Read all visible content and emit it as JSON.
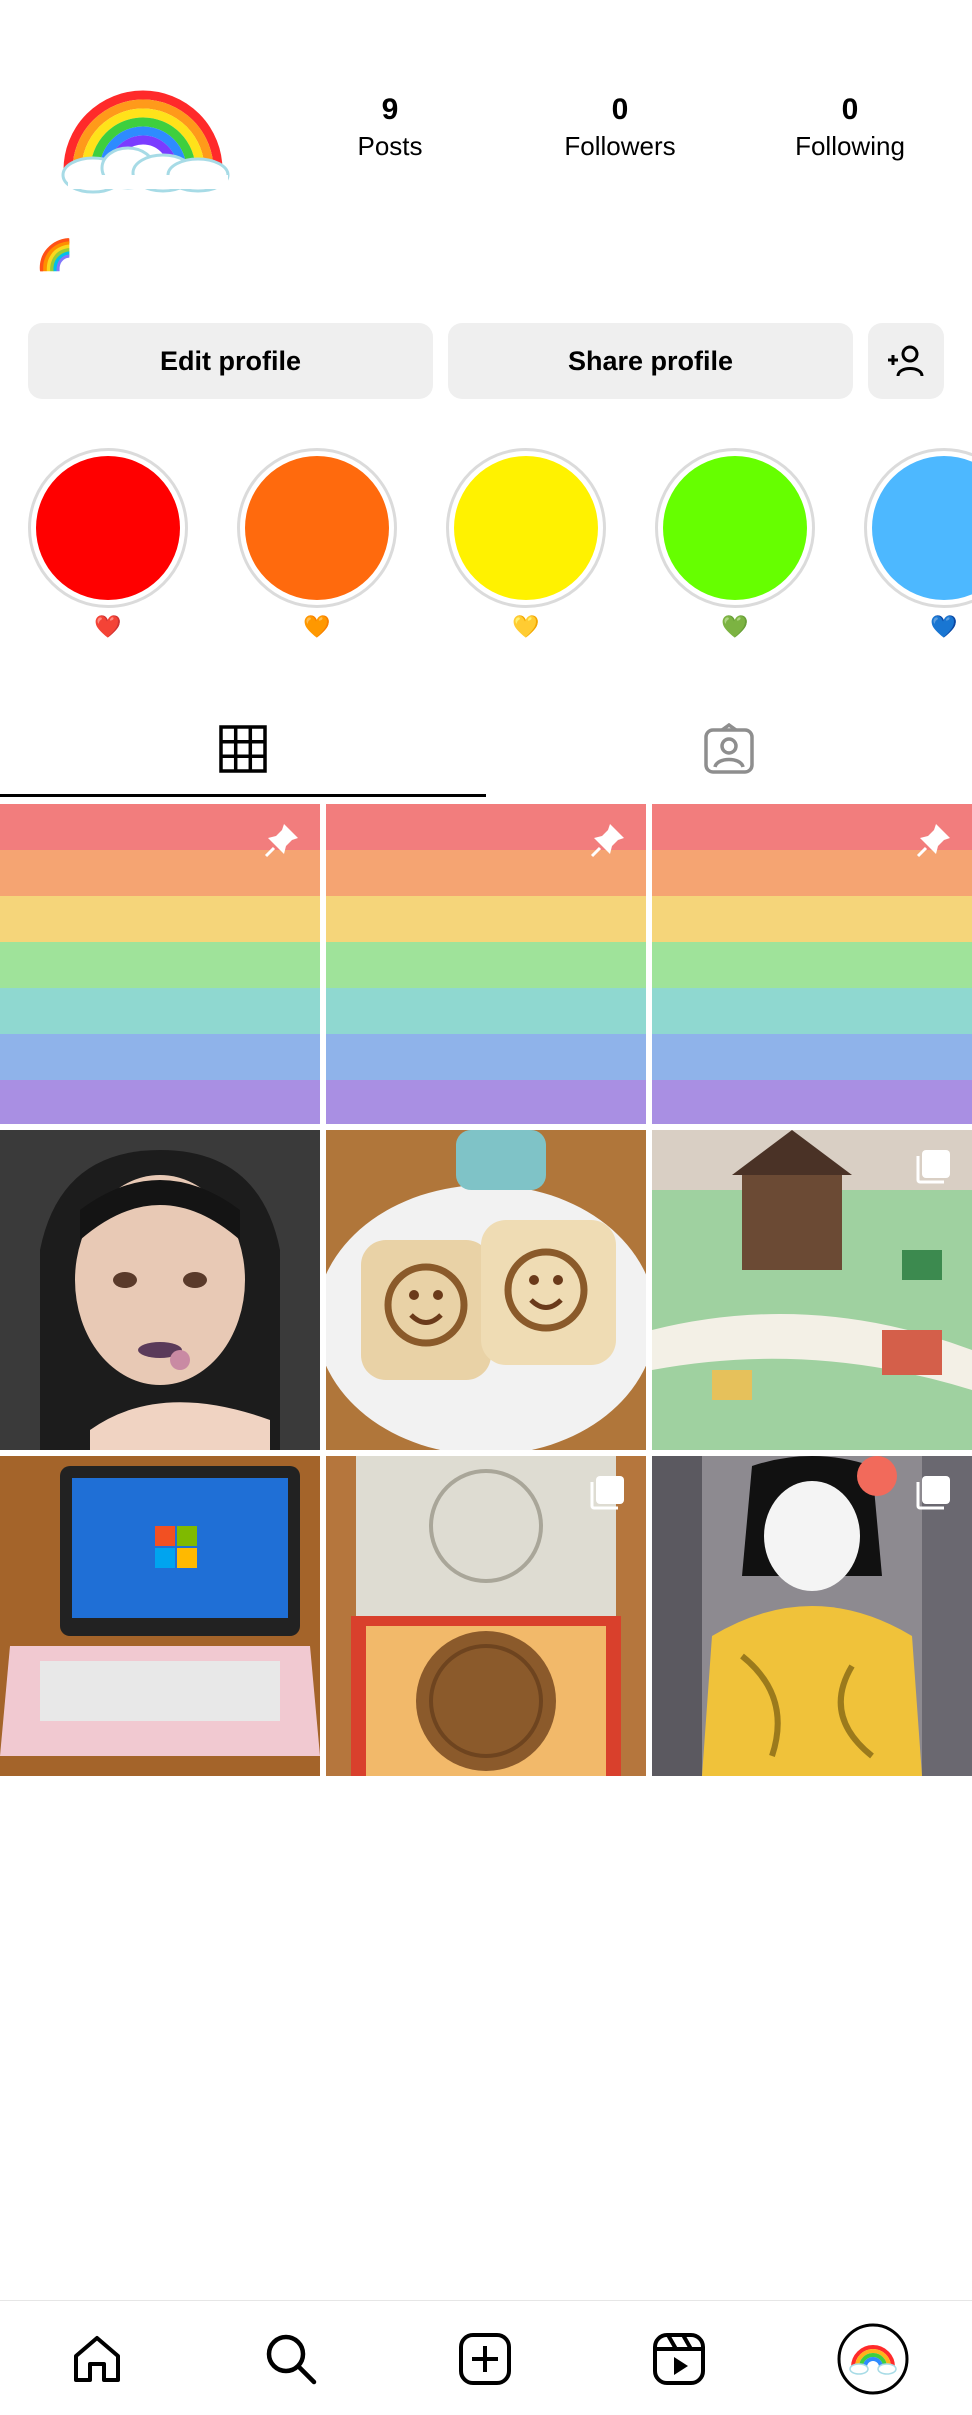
{
  "profile": {
    "stats": [
      {
        "count": "9",
        "label": "Posts"
      },
      {
        "count": "0",
        "label": "Followers"
      },
      {
        "count": "0",
        "label": "Following"
      }
    ],
    "bio": "🌈"
  },
  "buttons": {
    "edit_profile": "Edit profile",
    "share_profile": "Share profile",
    "add_person_icon": "add-person-icon"
  },
  "highlights": [
    {
      "label": "❤️",
      "color": "#ff0000"
    },
    {
      "label": "🧡",
      "color": "#ff6a0d"
    },
    {
      "label": "💛",
      "color": "#fff200"
    },
    {
      "label": "💚",
      "color": "#66ff00"
    },
    {
      "label": "💙",
      "color": "#4db8ff"
    }
  ],
  "tabs": [
    {
      "name": "posts-grid",
      "icon": "grid-icon",
      "active": true
    },
    {
      "name": "tagged",
      "icon": "tagged-person-icon",
      "active": false
    }
  ],
  "posts": [
    {
      "subject": "rainbow stripes",
      "pinned": true
    },
    {
      "subject": "rainbow stripes",
      "pinned": true
    },
    {
      "subject": "rainbow stripes",
      "pinned": true
    },
    {
      "subject": "selfie with ring",
      "pinned": false,
      "multi": false
    },
    {
      "subject": "smiley toast",
      "pinned": false,
      "multi": false
    },
    {
      "subject": "toy house diorama",
      "pinned": false,
      "multi": true
    },
    {
      "subject": "pink laptop",
      "pinned": false,
      "multi": false
    },
    {
      "subject": "mooncake in box",
      "pinned": false,
      "multi": true
    },
    {
      "subject": "hair salon",
      "pinned": false,
      "multi": true
    }
  ],
  "nav": [
    {
      "icon": "home-icon"
    },
    {
      "icon": "search-icon"
    },
    {
      "icon": "new-post-icon"
    },
    {
      "icon": "reels-icon"
    },
    {
      "icon": "profile-avatar-icon"
    }
  ]
}
